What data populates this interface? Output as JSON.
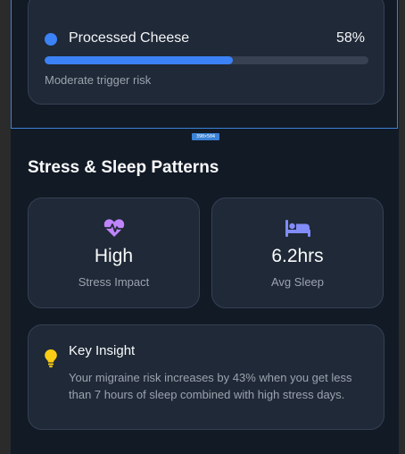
{
  "trigger": {
    "name": "Processed Cheese",
    "percent_label": "58%",
    "percent": 58,
    "risk_text": "Moderate trigger risk",
    "color": "#3b82f6"
  },
  "canvas": {
    "size_badge": "390×504"
  },
  "section": {
    "title": "Stress & Sleep Patterns"
  },
  "stats": [
    {
      "icon": "heart-pulse-icon",
      "value": "High",
      "label": "Stress Impact",
      "color": "#c084fc"
    },
    {
      "icon": "bed-icon",
      "value": "6.2hrs",
      "label": "Avg Sleep",
      "color": "#818cf8"
    }
  ],
  "insight": {
    "icon": "lightbulb-icon",
    "title": "Key Insight",
    "body": "Your migraine risk increases by 43% when you get less than 7 hours of sleep combined with high stress days.",
    "icon_color": "#facc15"
  }
}
